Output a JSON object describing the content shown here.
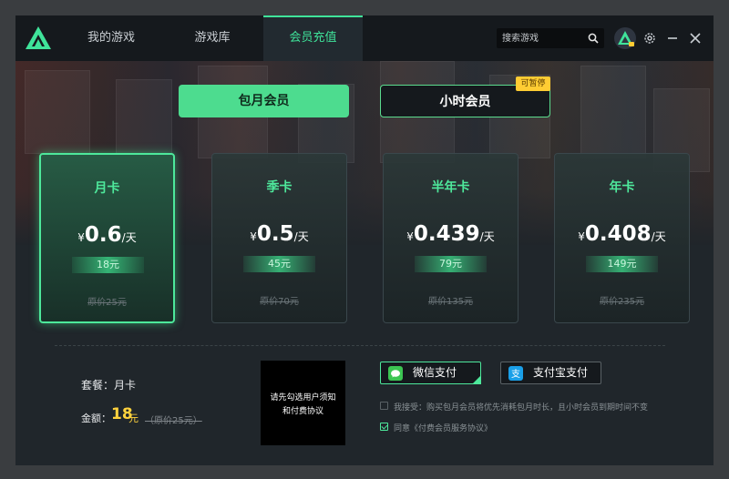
{
  "nav": {
    "tabs": [
      {
        "label": "我的游戏"
      },
      {
        "label": "游戏库"
      },
      {
        "label": "会员充值"
      }
    ],
    "active_tab": 2,
    "search_placeholder": "搜索游戏"
  },
  "plan_toggle": {
    "monthly_label": "包月会员",
    "hourly_label": "小时会员",
    "pause_badge": "可暂停"
  },
  "cards": [
    {
      "title": "月卡",
      "currency": "¥",
      "price": "0.6",
      "unit": "/天",
      "total": "18元",
      "original": "原价25元",
      "selected": true
    },
    {
      "title": "季卡",
      "currency": "¥",
      "price": "0.5",
      "unit": "/天",
      "total": "45元",
      "original": "原价70元",
      "selected": false
    },
    {
      "title": "半年卡",
      "currency": "¥",
      "price": "0.439",
      "unit": "/天",
      "total": "79元",
      "original": "原价135元",
      "selected": false
    },
    {
      "title": "年卡",
      "currency": "¥",
      "price": "0.408",
      "unit": "/天",
      "total": "149元",
      "original": "原价235元",
      "selected": false
    }
  ],
  "summary": {
    "package_label": "套餐：月卡",
    "amount_label": "金额：",
    "amount_value": "18",
    "amount_unit": "元",
    "amount_original": "（原价25元）"
  },
  "qr": {
    "line1": "请先勾选用户须知",
    "line2": "和付费协议"
  },
  "payment": {
    "wechat_label": "微信支付",
    "alipay_label": "支付宝支付",
    "selected": "wechat"
  },
  "agreements": {
    "notice_text": "我接受：购买包月会员将优先消耗包月时长，且小时会员到期时间不变",
    "notice_checked": false,
    "terms_text": "同意《付费会员服务协议》",
    "terms_checked": true
  },
  "colors": {
    "accent_green": "#4de89b",
    "price_yellow": "#ffd23d",
    "badge_yellow": "#ffcc33"
  },
  "icons": [
    "app-logo-icon",
    "search-icon",
    "avatar",
    "gear-icon",
    "minimize-icon",
    "close-icon",
    "wechat-pay-icon",
    "alipay-icon"
  ]
}
